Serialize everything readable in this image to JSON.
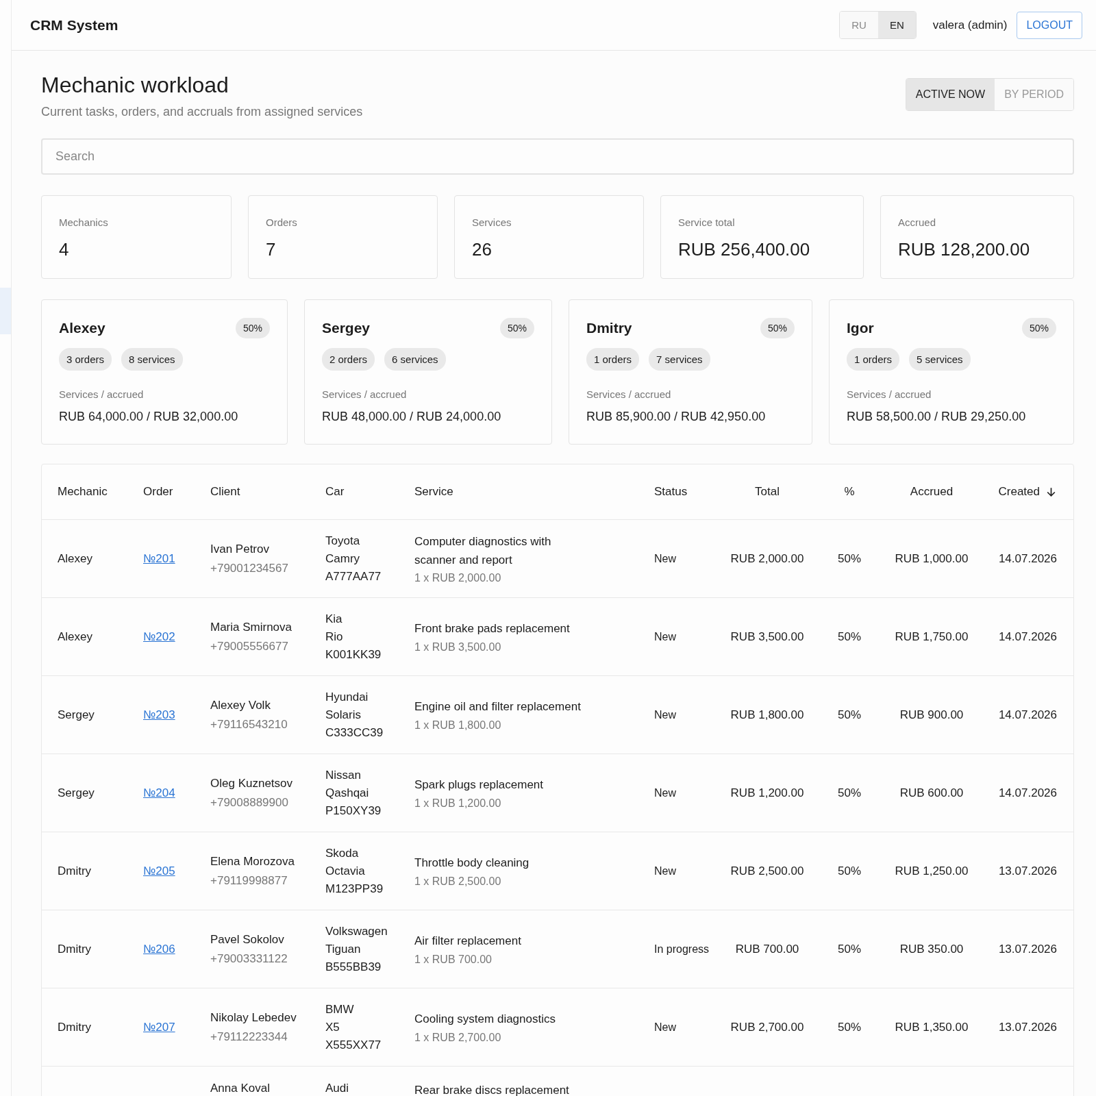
{
  "header": {
    "title": "CRM System",
    "languages": [
      {
        "label": "RU",
        "selected": false
      },
      {
        "label": "EN",
        "selected": true
      }
    ],
    "user": "valera (admin)",
    "logout": "LOGOUT"
  },
  "page": {
    "title": "Mechanic workload",
    "subtitle": "Current tasks, orders, and accruals from assigned services",
    "modes": [
      {
        "label": "ACTIVE NOW",
        "selected": true
      },
      {
        "label": "BY PERIOD",
        "selected": false
      }
    ]
  },
  "search": {
    "placeholder": "Search"
  },
  "stats": [
    {
      "label": "Mechanics",
      "value": "4"
    },
    {
      "label": "Orders",
      "value": "7"
    },
    {
      "label": "Services",
      "value": "26"
    },
    {
      "label": "Service total",
      "value": "RUB 256,400.00"
    },
    {
      "label": "Accrued",
      "value": "RUB 128,200.00"
    }
  ],
  "mechanics": [
    {
      "name": "Alexey",
      "percent": "50%",
      "orders": "3 orders",
      "services": "8 services",
      "totals_label": "Services / accrued",
      "totals": "RUB 64,000.00 / RUB 32,000.00"
    },
    {
      "name": "Sergey",
      "percent": "50%",
      "orders": "2 orders",
      "services": "6 services",
      "totals_label": "Services / accrued",
      "totals": "RUB 48,000.00 / RUB 24,000.00"
    },
    {
      "name": "Dmitry",
      "percent": "50%",
      "orders": "1 orders",
      "services": "7 services",
      "totals_label": "Services / accrued",
      "totals": "RUB 85,900.00 / RUB 42,950.00"
    },
    {
      "name": "Igor",
      "percent": "50%",
      "orders": "1 orders",
      "services": "5 services",
      "totals_label": "Services / accrued",
      "totals": "RUB 58,500.00 / RUB 29,250.00"
    }
  ],
  "table": {
    "columns": [
      {
        "label": "Mechanic",
        "sorted": false
      },
      {
        "label": "Order",
        "sorted": false
      },
      {
        "label": "Client",
        "sorted": false
      },
      {
        "label": "Car",
        "sorted": false
      },
      {
        "label": "Service",
        "sorted": false
      },
      {
        "label": "Status",
        "sorted": false
      },
      {
        "label": "Total",
        "sorted": false
      },
      {
        "label": "%",
        "sorted": false
      },
      {
        "label": "Accrued",
        "sorted": false
      },
      {
        "label": "Created",
        "sorted": true
      }
    ],
    "rows": [
      {
        "mechanic": "Alexey",
        "order": "№201",
        "client": "Ivan Petrov",
        "phone": "+79001234567",
        "car": [
          "Toyota",
          "Camry",
          "A777AA77"
        ],
        "service": "Computer diagnostics with scanner and report",
        "detail": "1 x RUB 2,000.00",
        "status": "New",
        "total": "RUB 2,000.00",
        "percent": "50%",
        "accrued": "RUB 1,000.00",
        "created": "14.07.2026"
      },
      {
        "mechanic": "Alexey",
        "order": "№202",
        "client": "Maria Smirnova",
        "phone": "+79005556677",
        "car": [
          "Kia",
          "Rio",
          "K001KK39"
        ],
        "service": "Front brake pads replacement",
        "detail": "1 x RUB 3,500.00",
        "status": "New",
        "total": "RUB 3,500.00",
        "percent": "50%",
        "accrued": "RUB 1,750.00",
        "created": "14.07.2026"
      },
      {
        "mechanic": "Sergey",
        "order": "№203",
        "client": "Alexey Volk",
        "phone": "+79116543210",
        "car": [
          "Hyundai",
          "Solaris",
          "C333CC39"
        ],
        "service": "Engine oil and filter replacement",
        "detail": "1 x RUB 1,800.00",
        "status": "New",
        "total": "RUB 1,800.00",
        "percent": "50%",
        "accrued": "RUB 900.00",
        "created": "14.07.2026"
      },
      {
        "mechanic": "Sergey",
        "order": "№204",
        "client": "Oleg Kuznetsov",
        "phone": "+79008889900",
        "car": [
          "Nissan",
          "Qashqai",
          "P150XY39"
        ],
        "service": "Spark plugs replacement",
        "detail": "1 x RUB 1,200.00",
        "status": "New",
        "total": "RUB 1,200.00",
        "percent": "50%",
        "accrued": "RUB 600.00",
        "created": "14.07.2026"
      },
      {
        "mechanic": "Dmitry",
        "order": "№205",
        "client": "Elena Morozova",
        "phone": "+79119998877",
        "car": [
          "Skoda",
          "Octavia",
          "M123PP39"
        ],
        "service": "Throttle body cleaning",
        "detail": "1 x RUB 2,500.00",
        "status": "New",
        "total": "RUB 2,500.00",
        "percent": "50%",
        "accrued": "RUB 1,250.00",
        "created": "13.07.2026"
      },
      {
        "mechanic": "Dmitry",
        "order": "№206",
        "client": "Pavel Sokolov",
        "phone": "+79003331122",
        "car": [
          "Volkswagen",
          "Tiguan",
          "B555BB39"
        ],
        "service": "Air filter replacement",
        "detail": "1 x RUB 700.00",
        "status": "In progress",
        "total": "RUB 700.00",
        "percent": "50%",
        "accrued": "RUB 350.00",
        "created": "13.07.2026"
      },
      {
        "mechanic": "Dmitry",
        "order": "№207",
        "client": "Nikolay Lebedev",
        "phone": "+79112223344",
        "car": [
          "BMW",
          "X5",
          "X555XX77"
        ],
        "service": "Cooling system diagnostics",
        "detail": "1 x RUB 2,700.00",
        "status": "New",
        "total": "RUB 2,700.00",
        "percent": "50%",
        "accrued": "RUB 1,350.00",
        "created": "13.07.2026"
      },
      {
        "client": "Anna Koval",
        "car": [
          "Audi"
        ],
        "service": "Rear brake discs replacement"
      }
    ]
  }
}
